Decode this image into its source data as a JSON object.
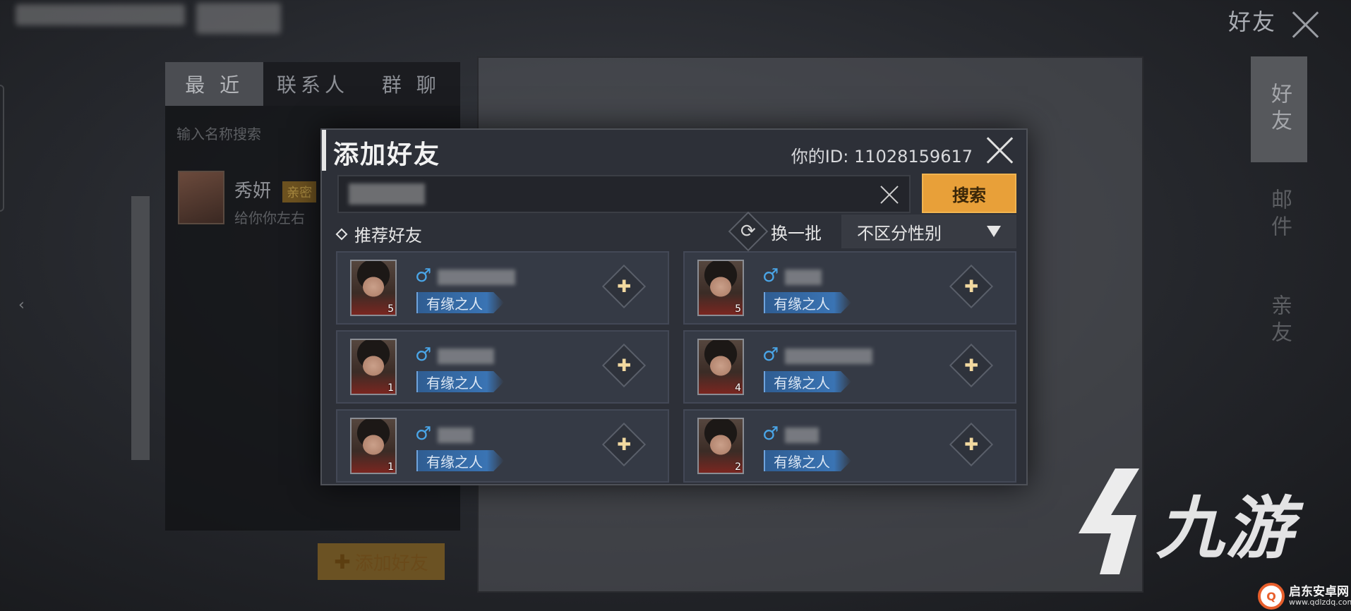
{
  "screen": {
    "title": "好友"
  },
  "left_panel": {
    "tabs": [
      {
        "label": "最 近",
        "active": true
      },
      {
        "label": "联系人",
        "active": false
      },
      {
        "label": "群 聊",
        "active": false
      }
    ],
    "search_placeholder": "输入名称搜索",
    "recent_chat": {
      "name": "秀妍",
      "tag": "亲密",
      "message": "给你你左右"
    },
    "add_friend_button": "添加好友"
  },
  "right_tabs": [
    {
      "label": "好友",
      "active": true
    },
    {
      "label": "邮件",
      "active": false
    },
    {
      "label": "亲友",
      "active": false
    }
  ],
  "modal": {
    "title": "添加好友",
    "your_id_label": "你的ID:",
    "your_id_value": "11028159617",
    "search_button": "搜索",
    "recommend_label": "推荐好友",
    "refresh_label": "换一批",
    "gender_filter": "不区分性别",
    "recommendations": [
      {
        "level": "5",
        "gender": "♂",
        "tag": "有缘之人"
      },
      {
        "level": "5",
        "gender": "♂",
        "tag": "有缘之人"
      },
      {
        "level": "1",
        "gender": "♂",
        "tag": "有缘之人"
      },
      {
        "level": "4",
        "gender": "♂",
        "tag": "有缘之人"
      },
      {
        "level": "1",
        "gender": "♂",
        "tag": "有缘之人"
      },
      {
        "level": "2",
        "gender": "♂",
        "tag": "有缘之人"
      }
    ]
  },
  "icons": {
    "close": "close-icon",
    "clear": "clear-icon",
    "refresh": "refresh-icon",
    "add_friend": "add-friend-icon",
    "gender": "male-icon",
    "caret": "caret-down-icon",
    "diamond": "diamond-icon"
  },
  "colors": {
    "accent_orange": "#e8a039",
    "tag_blue": "#3a74b4",
    "male_blue": "#4aa6e8",
    "panel_bg": "#2d3038"
  },
  "watermark": {
    "brand": "九游",
    "site_name": "启东安卓网",
    "site_url": "www.qdlzdq.com"
  }
}
